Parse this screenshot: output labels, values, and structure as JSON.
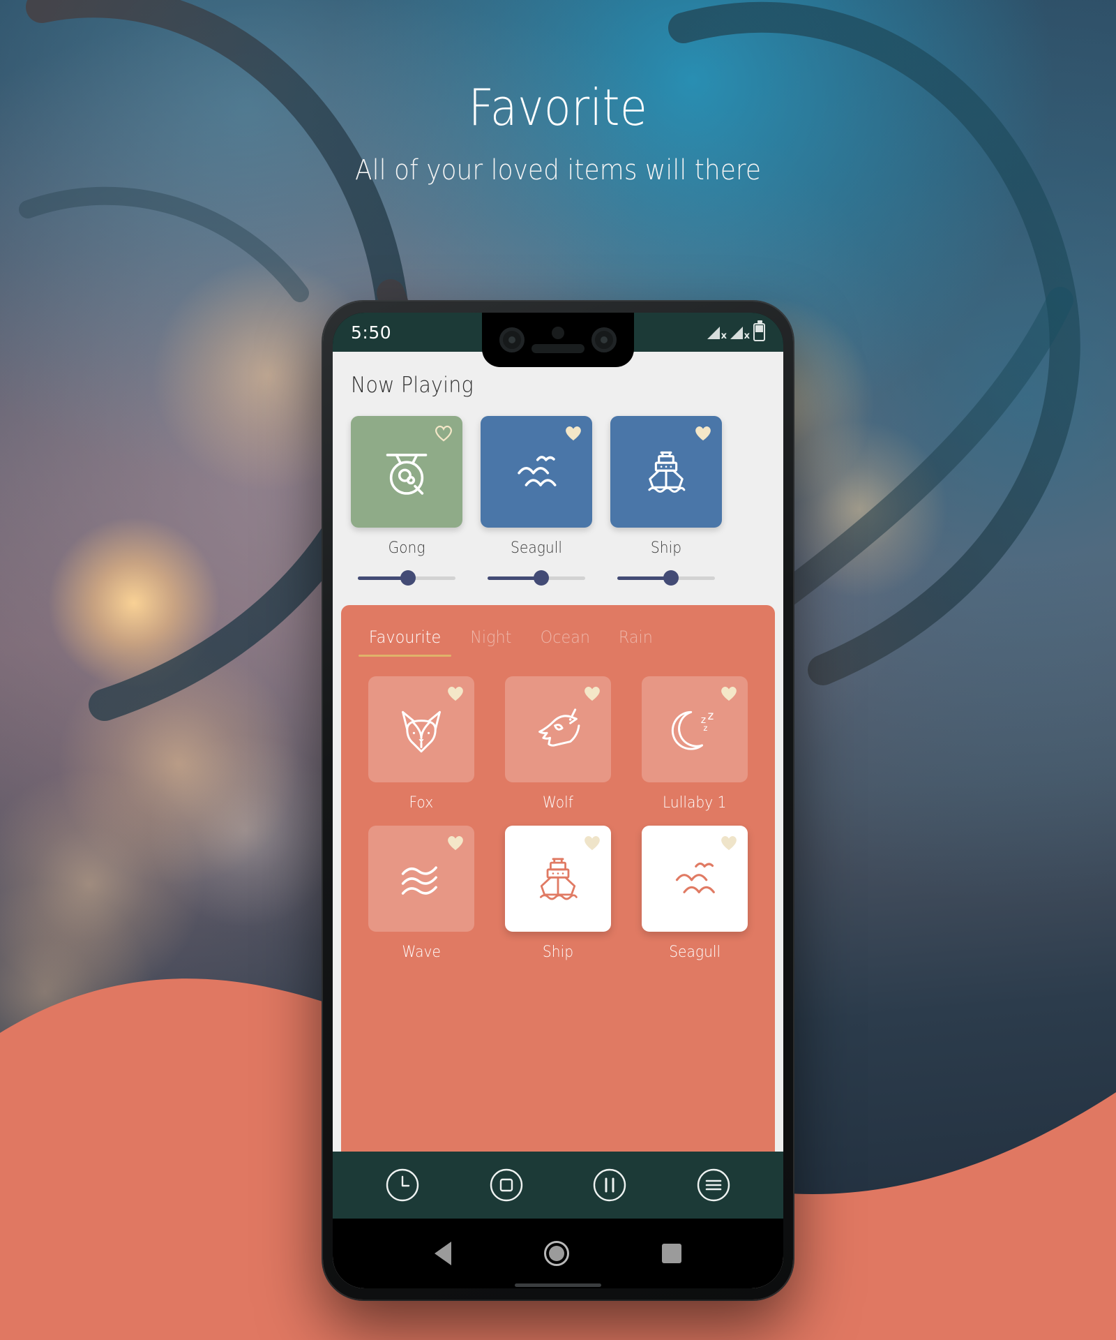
{
  "header": {
    "title": "Favorite",
    "subtitle": "All of your loved items will there"
  },
  "colors": {
    "coral": "#e07a63",
    "coral_wave": "#e07862",
    "status_bar": "#1c3a37",
    "app_bg": "#efefef",
    "slider": "#434b75",
    "tab_underline": "#e0b36a",
    "heart_filled": "#f4e7c8",
    "card_green": "#8fab88",
    "card_blue": "#4a76a8",
    "night_bg": "#1d2a38"
  },
  "phone": {
    "status": {
      "time": "5:50",
      "signal_icons": [
        "signal-x-icon",
        "signal-x-icon"
      ],
      "battery_icon": "battery-icon"
    },
    "now_playing": {
      "title": "Now Playing",
      "items": [
        {
          "label": "Gong",
          "icon": "gong-icon",
          "card_color": "#8fab88",
          "favorited": false,
          "heart_icon": "heart-outline-icon",
          "volume": 45
        },
        {
          "label": "Seagull",
          "icon": "seagull-icon",
          "card_color": "#4a76a8",
          "favorited": true,
          "heart_icon": "heart-filled-icon",
          "volume": 48
        },
        {
          "label": "Ship",
          "icon": "ship-icon",
          "card_color": "#4a76a8",
          "favorited": true,
          "heart_icon": "heart-filled-icon",
          "volume": 48
        }
      ]
    },
    "library": {
      "tabs": [
        {
          "label": "Favourite",
          "active": true
        },
        {
          "label": "Night",
          "active": false
        },
        {
          "label": "Ocean",
          "active": false
        },
        {
          "label": "Rain",
          "active": false
        }
      ],
      "items": [
        {
          "label": "Fox",
          "icon": "fox-icon",
          "style": "tint",
          "favorited": true,
          "heart_icon": "heart-filled-icon"
        },
        {
          "label": "Wolf",
          "icon": "wolf-icon",
          "style": "tint",
          "favorited": true,
          "heart_icon": "heart-filled-icon"
        },
        {
          "label": "Lullaby 1",
          "icon": "moon-zzz-icon",
          "style": "tint",
          "favorited": true,
          "heart_icon": "heart-filled-icon"
        },
        {
          "label": "Wave",
          "icon": "wave-icon",
          "style": "tint",
          "favorited": true,
          "heart_icon": "heart-filled-icon"
        },
        {
          "label": "Ship",
          "icon": "ship-icon",
          "style": "white",
          "favorited": true,
          "heart_icon": "heart-filled-icon"
        },
        {
          "label": "Seagull",
          "icon": "seagull-icon",
          "style": "white",
          "favorited": true,
          "heart_icon": "heart-filled-icon"
        }
      ]
    },
    "player_bar": {
      "buttons": [
        {
          "name": "timer-button",
          "icon": "clock-circle-icon"
        },
        {
          "name": "stop-button",
          "icon": "stop-circle-icon"
        },
        {
          "name": "pause-button",
          "icon": "pause-circle-icon"
        },
        {
          "name": "menu-button",
          "icon": "menu-circle-icon"
        }
      ]
    },
    "android_nav": {
      "back": "back-triangle-icon",
      "home": "home-circle-icon",
      "recents": "recents-square-icon"
    }
  }
}
